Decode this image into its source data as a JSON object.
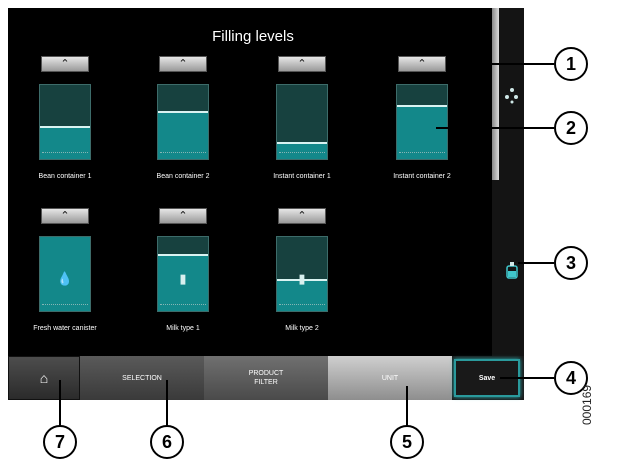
{
  "title": "Filling levels",
  "containers": [
    {
      "label": "Bean container 1",
      "level": 0.42,
      "icon": ""
    },
    {
      "label": "Bean container 2",
      "level": 0.62,
      "icon": ""
    },
    {
      "label": "Instant container 1",
      "level": 0.2,
      "icon": ""
    },
    {
      "label": "Instant container 2",
      "level": 0.7,
      "icon": ""
    },
    {
      "label": "Fresh water canister",
      "level": 1.0,
      "icon": "💧"
    },
    {
      "label": "Milk type 1",
      "level": 0.75,
      "icon": "▮"
    },
    {
      "label": "Milk type 2",
      "level": 0.4,
      "icon": "▮"
    }
  ],
  "up_button_symbol": "⌃",
  "nav": {
    "home_icon": "⌂",
    "selection": "SELECTION",
    "product_filter": "PRODUCT FILTER",
    "unit": "UNIT",
    "save": "Save"
  },
  "sidebar": {
    "top_icon": "drops-icon",
    "bottom_icon": "canister-icon"
  },
  "callouts": [
    "1",
    "2",
    "3",
    "4",
    "5",
    "6",
    "7"
  ],
  "doc_id": "000169",
  "colors": {
    "tank_empty": "#17413f",
    "tank_fill": "#13888a",
    "save_border": "#2a9a9c"
  }
}
